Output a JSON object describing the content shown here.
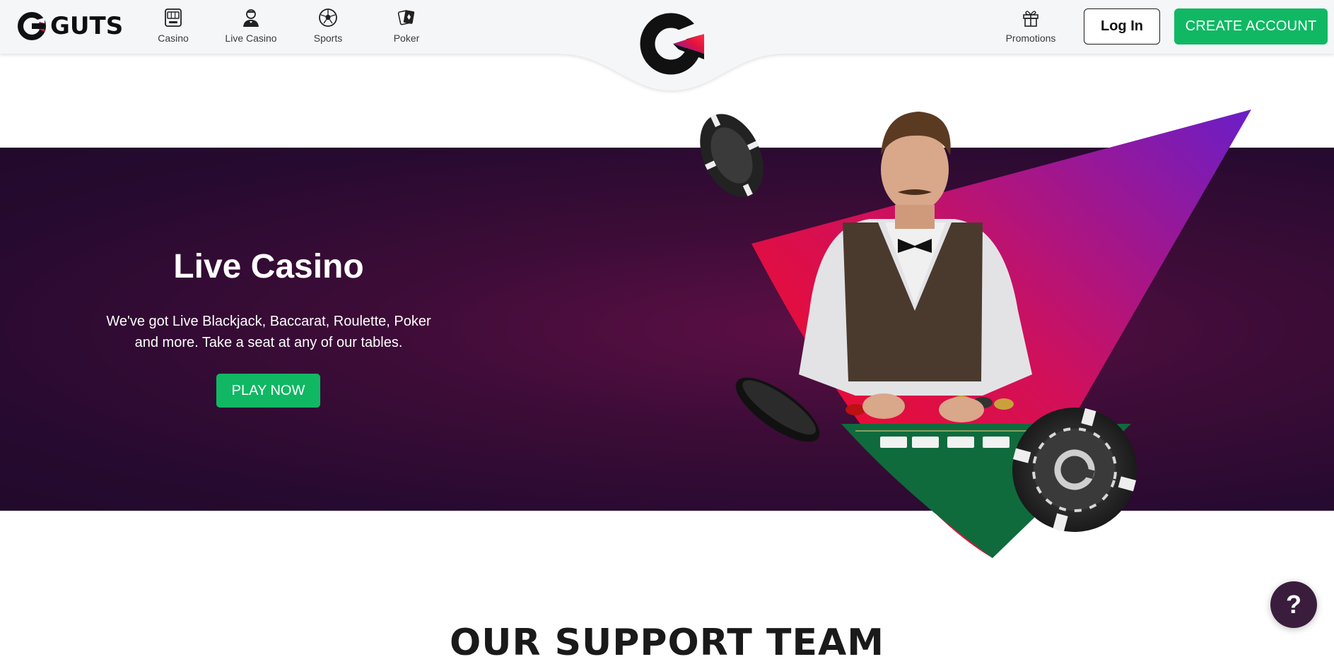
{
  "brand": {
    "name": "GUTS"
  },
  "nav": [
    {
      "label": "Casino",
      "icon": "slot-machine-icon"
    },
    {
      "label": "Live Casino",
      "icon": "dealer-icon"
    },
    {
      "label": "Sports",
      "icon": "soccer-ball-icon"
    },
    {
      "label": "Poker",
      "icon": "playing-cards-icon"
    }
  ],
  "header_right": {
    "promotions_label": "Promotions",
    "promotions_icon": "gift-icon",
    "login_label": "Log In",
    "create_account_label": "CREATE ACCOUNT"
  },
  "hero": {
    "title": "Live Casino",
    "subtitle": "We've got Live Blackjack, Baccarat, Roulette, Poker and more. Take a seat at any of our tables.",
    "cta_label": "PLAY NOW"
  },
  "support": {
    "title": "OUR SUPPORT TEAM"
  },
  "help_button": {
    "label": "?",
    "icon": "question-icon"
  },
  "colors": {
    "accent_green": "#10b863",
    "hero_purple": "#260a2f",
    "brand_red": "#e4133a",
    "brand_purple": "#6b1cc7"
  }
}
